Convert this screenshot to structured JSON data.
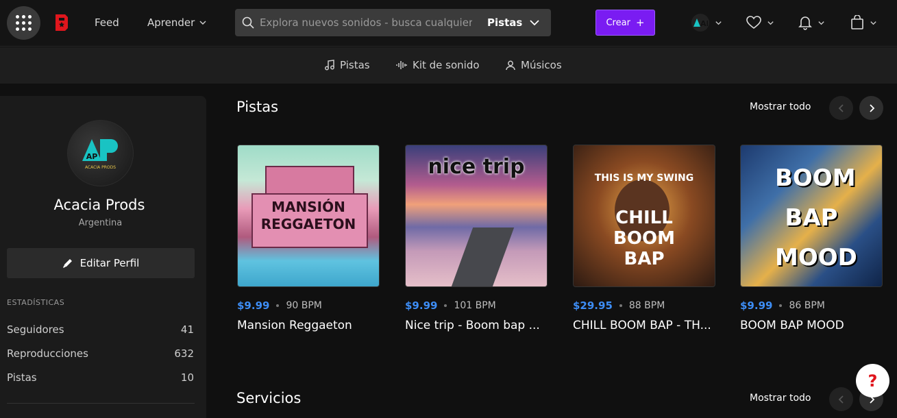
{
  "header": {
    "nav": {
      "feed": "Feed",
      "learn": "Aprender"
    },
    "search": {
      "placeholder": "Explora nuevos sonidos - busca cualquier cosa",
      "type": "Pistas"
    },
    "create_label": "Crear",
    "avatar_text": "AP"
  },
  "subnav": {
    "items": [
      {
        "label": "Pistas",
        "icon": "music-note-icon"
      },
      {
        "label": "Kit de sonido",
        "icon": "waveform-icon"
      },
      {
        "label": "Músicos",
        "icon": "user-icon"
      }
    ]
  },
  "profile": {
    "avatar_letters": "AP",
    "avatar_caption": "ACACIA PRODS",
    "name": "Acacia Prods",
    "country": "Argentina",
    "edit_label": "Editar Perfil",
    "stats_title": "ESTADÍSTICAS",
    "stats": [
      {
        "label": "Seguidores",
        "value": "41"
      },
      {
        "label": "Reproducciones",
        "value": "632"
      },
      {
        "label": "Pistas",
        "value": "10"
      }
    ]
  },
  "tracks_section": {
    "title": "Pistas",
    "show_all": "Mostrar todo",
    "tracks": [
      {
        "price": "$9.99",
        "bpm": "90 BPM",
        "name": "Mansion Reggaeton",
        "cover_text": "MANSIÓN REGGAETON"
      },
      {
        "price": "$9.99",
        "bpm": "101 BPM",
        "name": "Nice trip - Boom bap ...",
        "cover_text": "nice trip"
      },
      {
        "price": "$29.95",
        "bpm": "88 BPM",
        "name": "CHILL BOOM BAP - TH...",
        "cover_text": "THIS IS MY SWING",
        "cover_text_2": "CHILL BOOM BAP"
      },
      {
        "price": "$9.99",
        "bpm": "86 BPM",
        "name": "BOOM BAP MOOD",
        "cover_text": "BOOM BAP MOOD"
      }
    ]
  },
  "services_section": {
    "title": "Servicios",
    "show_all": "Mostrar todo"
  },
  "help_label": "?",
  "colors": {
    "accent_purple": "#7a1cf2",
    "price_blue": "#3d8df5",
    "logo_red": "#e0161d"
  }
}
